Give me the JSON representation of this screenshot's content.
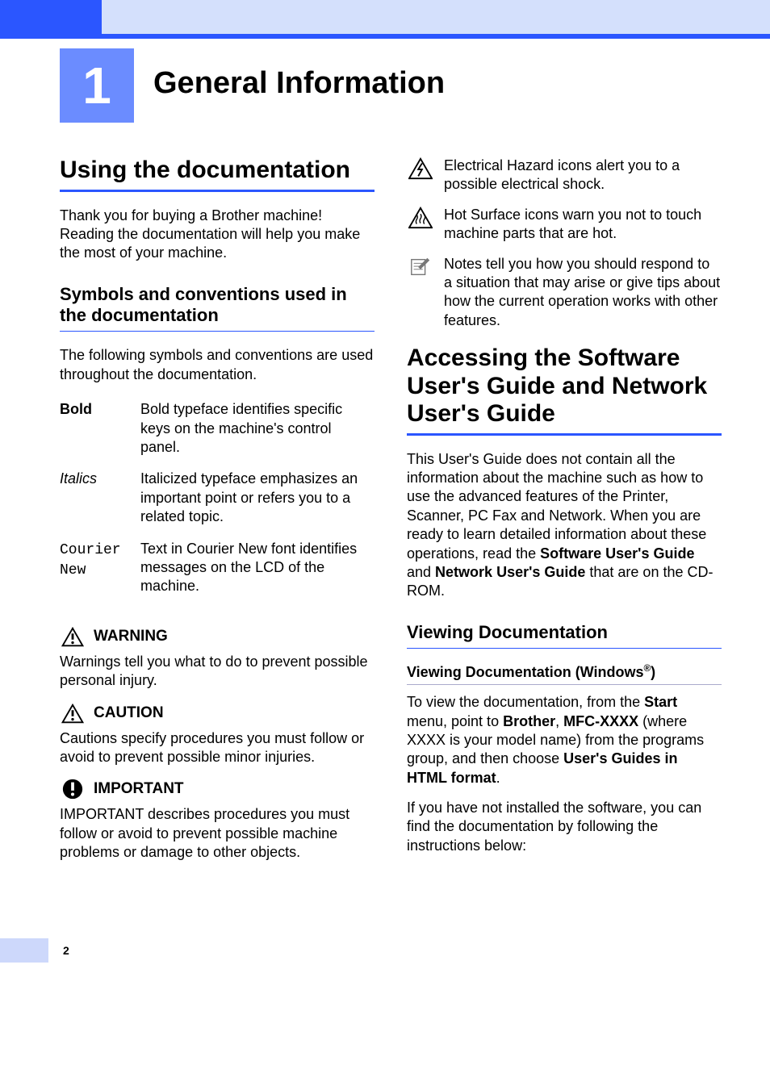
{
  "chapter": {
    "number": "1",
    "title": "General Information"
  },
  "left": {
    "h2": "Using the documentation",
    "intro": "Thank you for buying a Brother machine! Reading the documentation will help you make the most of your machine.",
    "h3_symbols": "Symbols and conventions used in the documentation",
    "symbols_para": "The following symbols and conventions are used throughout the documentation.",
    "conv": [
      {
        "term": "Bold",
        "cls": "bold-term",
        "desc": "Bold typeface identifies specific keys on the machine's control panel."
      },
      {
        "term": "Italics",
        "cls": "italic-term",
        "desc": "Italicized typeface emphasizes an important point or refers you to a related topic."
      },
      {
        "term": "Courier New",
        "cls": "mono-term",
        "desc": "Text in Courier New font identifies messages on the LCD of the machine."
      }
    ],
    "warning_label": "WARNING",
    "warning_text": "Warnings tell you what to do to prevent possible personal injury.",
    "caution_label": "CAUTION",
    "caution_text": "Cautions specify procedures you must follow or avoid to prevent possible minor injuries.",
    "important_label": "IMPORTANT",
    "important_text": "IMPORTANT describes procedures you must follow or avoid to prevent possible machine problems or damage to other objects."
  },
  "right": {
    "electrical": "Electrical Hazard icons alert you to a possible electrical shock.",
    "hot": "Hot Surface icons warn you not to touch machine parts that are hot.",
    "note": "Notes tell you how you should respond to a situation that may arise or give tips about how the current operation works with other features.",
    "h2_access": "Accessing the Software User's Guide and Network User's Guide",
    "access_para_pre": "This User's Guide does not contain all the information about the machine such as how to use the advanced features of the Printer, Scanner, PC Fax and Network. When you are ready to learn detailed information about these operations, read the ",
    "sw_guide": "Software User's Guide",
    "and_txt": " and ",
    "nw_guide": "Network User's Guide",
    "access_para_post": " that are on the CD-ROM.",
    "h3_viewing": "Viewing Documentation",
    "h4_windows_pre": "Viewing Documentation (Windows",
    "h4_windows_sup": "®",
    "h4_windows_post": ")",
    "view_para1_pre": "To view the documentation, from the ",
    "start_b": "Start",
    "view_para1_mid1": " menu, point to ",
    "brother_b": "Brother",
    "comma": ", ",
    "mfc_b": "MFC-XXXX",
    "view_para1_mid2": " (where XXXX is your model name) from the programs group, and then choose ",
    "guides_b": "User's Guides in HTML format",
    "period": ".",
    "view_para2": "If you have not installed the software, you can find the documentation by following the instructions below:"
  },
  "page_number": "2"
}
